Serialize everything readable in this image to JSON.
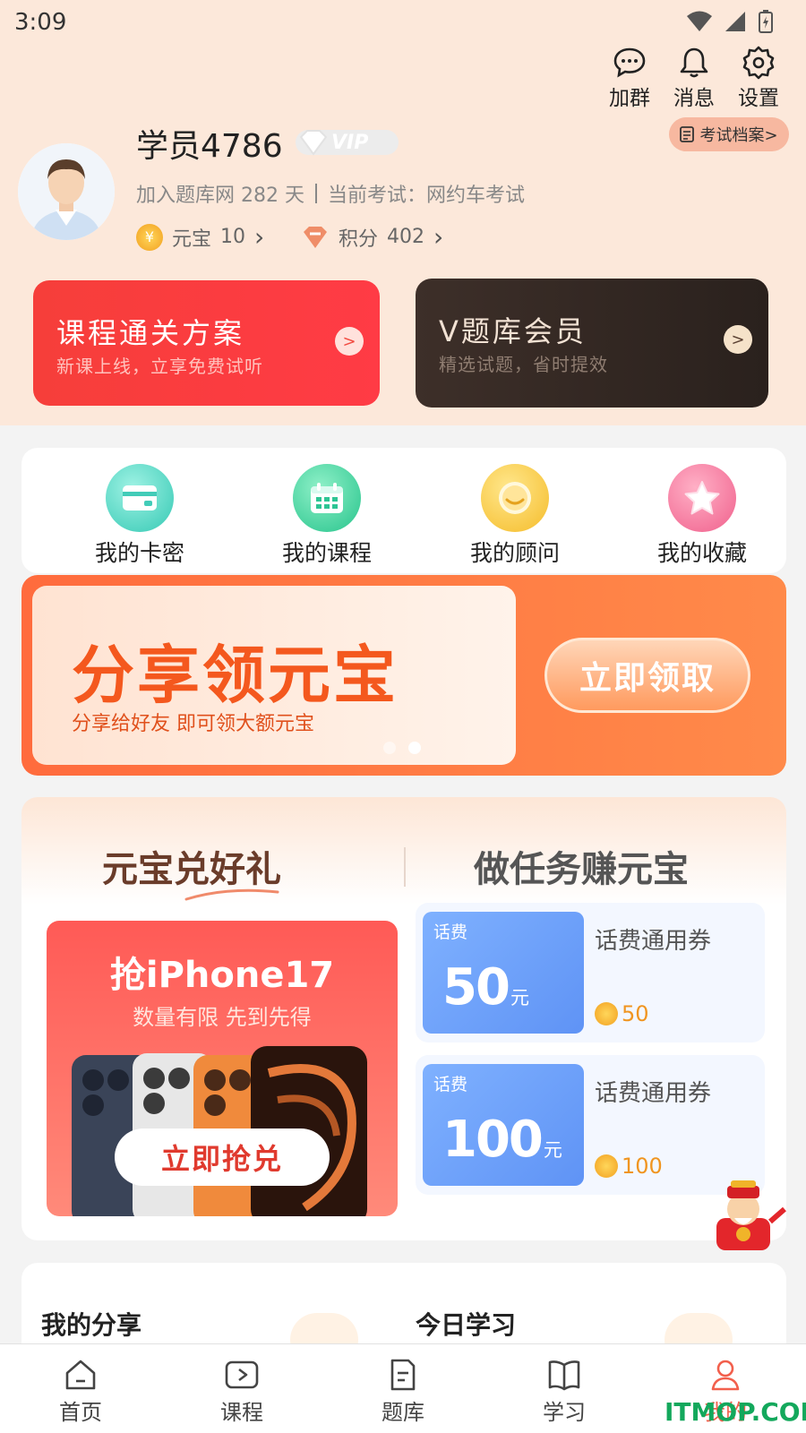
{
  "status": {
    "time": "3:09"
  },
  "header": {
    "actions": [
      {
        "label": "加群",
        "icon": "chat-bubble-icon"
      },
      {
        "label": "消息",
        "icon": "bell-icon"
      },
      {
        "label": "设置",
        "icon": "gear-icon"
      }
    ],
    "username": "学员4786",
    "vip_label": "VIP",
    "dossier_label": "考试档案>",
    "joined_text": "加入题库网 282 天",
    "current_exam": "当前考试：网约车考试",
    "coins": {
      "label": "元宝",
      "value": "10"
    },
    "points": {
      "label": "积分",
      "value": "402"
    }
  },
  "promo_cards": [
    {
      "title": "课程通关方案",
      "subtitle": "新课上线，立享免费试听",
      "go": ">"
    },
    {
      "title": "V题库会员",
      "subtitle": "精选试题，省时提效",
      "go": ">"
    }
  ],
  "quick_links": [
    {
      "label": "我的卡密",
      "icon": "card-icon"
    },
    {
      "label": "我的课程",
      "icon": "calendar-icon"
    },
    {
      "label": "我的顾问",
      "icon": "chat-face-icon"
    },
    {
      "label": "我的收藏",
      "icon": "star-icon"
    }
  ],
  "share_banner": {
    "title": "分享领元宝",
    "subtitle": "分享给好友 即可领大额元宝",
    "button": "立即领取"
  },
  "rewards": {
    "tabs": [
      "元宝兑好礼",
      "做任务赚元宝"
    ],
    "promo": {
      "title": "抢iPhone17",
      "subtitle": "数量有限 先到先得",
      "button": "立即抢兑"
    },
    "coupons": [
      {
        "tag": "话费",
        "amount": "50",
        "unit": "元",
        "name": "话费通用券",
        "price": "50"
      },
      {
        "tag": "话费",
        "amount": "100",
        "unit": "元",
        "name": "话费通用券",
        "price": "100"
      }
    ]
  },
  "bottom_section": {
    "left_title": "我的分享",
    "right_title": "今日学习"
  },
  "nav": [
    {
      "label": "首页",
      "icon": "home-icon"
    },
    {
      "label": "课程",
      "icon": "play-icon"
    },
    {
      "label": "题库",
      "icon": "question-bank-icon"
    },
    {
      "label": "学习",
      "icon": "book-icon"
    },
    {
      "label": "我的",
      "icon": "profile-icon",
      "active": true
    }
  ],
  "watermark": "ITMOP.COM",
  "colors": {
    "accent": "#f2604d",
    "header_bg": "#fce8da",
    "coupon_blue": "#6a9cf7"
  }
}
